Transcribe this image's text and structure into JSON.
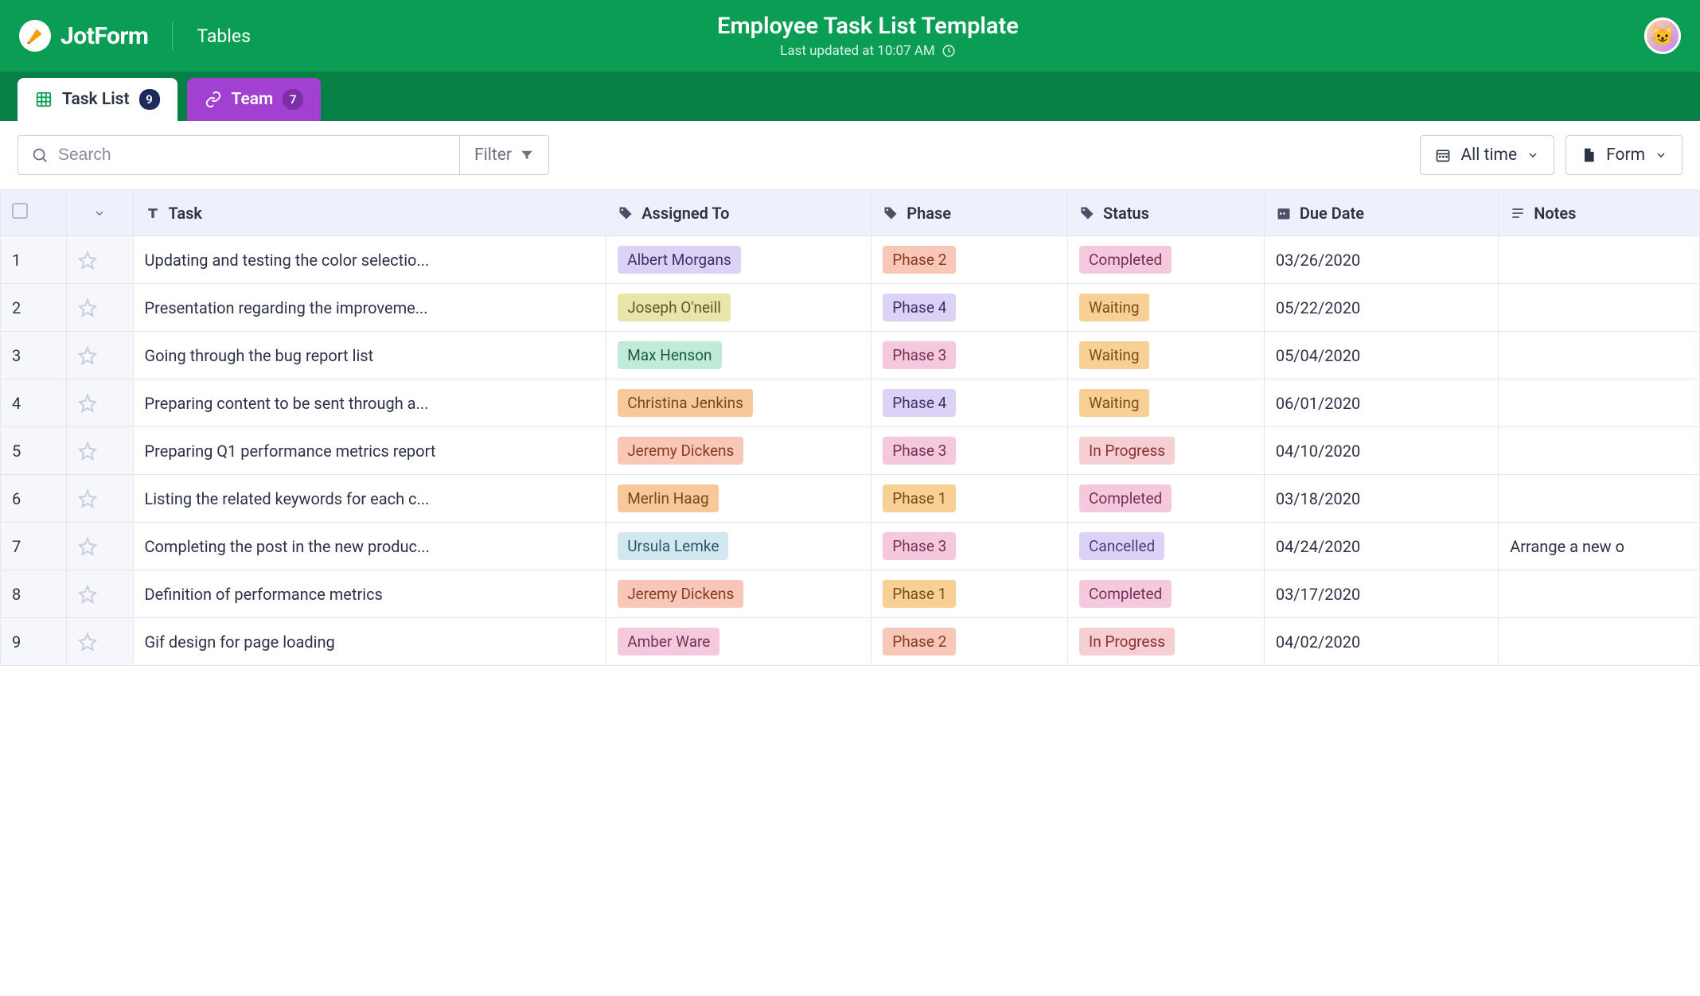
{
  "brand": "JotForm",
  "section": "Tables",
  "title": "Employee Task List Template",
  "updated_label": "Last updated at 10:07 AM",
  "tabs": {
    "task_list": {
      "label": "Task List",
      "count": "9"
    },
    "team": {
      "label": "Team",
      "count": "7"
    }
  },
  "toolbar": {
    "search_placeholder": "Search",
    "filter_label": "Filter",
    "range_label": "All time",
    "form_label": "Form"
  },
  "columns": {
    "task": "Task",
    "assigned": "Assigned To",
    "phase": "Phase",
    "status": "Status",
    "due": "Due Date",
    "notes": "Notes"
  },
  "rows": [
    {
      "idx": "1",
      "task": "Updating and testing the color selectio...",
      "assigned": "Albert Morgans",
      "assigned_cls": "tag-lavender",
      "phase": "Phase 2",
      "phase_cls": "tag-peach",
      "status": "Completed",
      "status_cls": "tag-pink",
      "due": "03/26/2020",
      "notes": ""
    },
    {
      "idx": "2",
      "task": "Presentation regarding the improveme...",
      "assigned": "Joseph O'neill",
      "assigned_cls": "tag-olive",
      "phase": "Phase 4",
      "phase_cls": "tag-lavender",
      "status": "Waiting",
      "status_cls": "tag-amber",
      "due": "05/22/2020",
      "notes": ""
    },
    {
      "idx": "3",
      "task": "Going through the bug report list",
      "assigned": "Max Henson",
      "assigned_cls": "tag-mint",
      "phase": "Phase 3",
      "phase_cls": "tag-pink",
      "status": "Waiting",
      "status_cls": "tag-amber",
      "due": "05/04/2020",
      "notes": ""
    },
    {
      "idx": "4",
      "task": "Preparing content to be sent through a...",
      "assigned": "Christina Jenkins",
      "assigned_cls": "tag-orange",
      "phase": "Phase 4",
      "phase_cls": "tag-lavender",
      "status": "Waiting",
      "status_cls": "tag-amber",
      "due": "06/01/2020",
      "notes": ""
    },
    {
      "idx": "5",
      "task": "Preparing Q1 performance metrics report",
      "assigned": "Jeremy Dickens",
      "assigned_cls": "tag-peach",
      "phase": "Phase 3",
      "phase_cls": "tag-pink",
      "status": "In Progress",
      "status_cls": "tag-rosy",
      "due": "04/10/2020",
      "notes": ""
    },
    {
      "idx": "6",
      "task": "Listing the related keywords for each c...",
      "assigned": "Merlin Haag",
      "assigned_cls": "tag-orange",
      "phase": "Phase 1",
      "phase_cls": "tag-amber",
      "status": "Completed",
      "status_cls": "tag-pink",
      "due": "03/18/2020",
      "notes": ""
    },
    {
      "idx": "7",
      "task": "Completing the post in the new produc...",
      "assigned": "Ursula Lemke",
      "assigned_cls": "tag-blue",
      "phase": "Phase 3",
      "phase_cls": "tag-pink",
      "status": "Cancelled",
      "status_cls": "tag-violet",
      "due": "04/24/2020",
      "notes": "Arrange a new o"
    },
    {
      "idx": "8",
      "task": "Definition of performance metrics",
      "assigned": "Jeremy Dickens",
      "assigned_cls": "tag-peach",
      "phase": "Phase 1",
      "phase_cls": "tag-amber",
      "status": "Completed",
      "status_cls": "tag-pink",
      "due": "03/17/2020",
      "notes": ""
    },
    {
      "idx": "9",
      "task": "Gif design for page loading",
      "assigned": "Amber Ware",
      "assigned_cls": "tag-pink",
      "phase": "Phase 2",
      "phase_cls": "tag-peach",
      "status": "In Progress",
      "status_cls": "tag-rosy",
      "due": "04/02/2020",
      "notes": ""
    }
  ]
}
